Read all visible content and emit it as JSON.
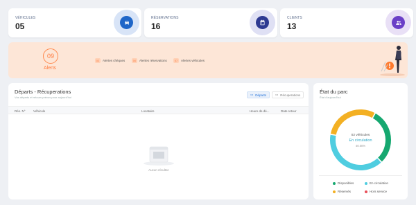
{
  "stats": [
    {
      "label": "VÉHICULES",
      "value": "05",
      "icon": "car-icon",
      "ring": "#d8e4f7",
      "color": "#1f66c8"
    },
    {
      "label": "RÉSERVATIONS",
      "value": "16",
      "icon": "calendar-icon",
      "ring": "#dfe0f4",
      "color": "#2e3a92"
    },
    {
      "label": "CLIENTS",
      "value": "13",
      "icon": "users-icon",
      "ring": "#e9e0f6",
      "color": "#6b3fc7"
    }
  ],
  "banner": {
    "count": "09",
    "label": "Alerts",
    "chips": [
      {
        "num": "02",
        "text": "Alertes chèques"
      },
      {
        "num": "00",
        "text": "Alertes réservations"
      },
      {
        "num": "07",
        "text": "Alertes véhicules"
      }
    ]
  },
  "departures": {
    "title": "Départs - Récuperations",
    "subtitle": "Vos départs et retours prévus pour aujourd'hui",
    "tab_active": "Départs",
    "tab_inactive": "Récuperations",
    "columns": [
      "Rés. N°",
      "Véhicule",
      "Locataire",
      "Heure de dé...",
      "Date retour"
    ],
    "empty": "Aucun résultat"
  },
  "fleet": {
    "title": "État du parc",
    "subtitle": "État d'aujourd'hui",
    "center_count": "02 véhicules",
    "center_label": "En circulation",
    "center_pct": "40.00%",
    "legend": [
      {
        "label": "Disponibles",
        "color": "#16a870"
      },
      {
        "label": "En circulation",
        "color": "#4fcde0"
      },
      {
        "label": "Réservés",
        "color": "#f3b023"
      },
      {
        "label": "Hors service",
        "color": "#e9505a"
      }
    ]
  },
  "chart_data": {
    "type": "pie",
    "categories": [
      "Disponibles",
      "En circulation",
      "Réservés",
      "Hors service"
    ],
    "values": [
      30,
      40,
      30,
      0
    ]
  }
}
